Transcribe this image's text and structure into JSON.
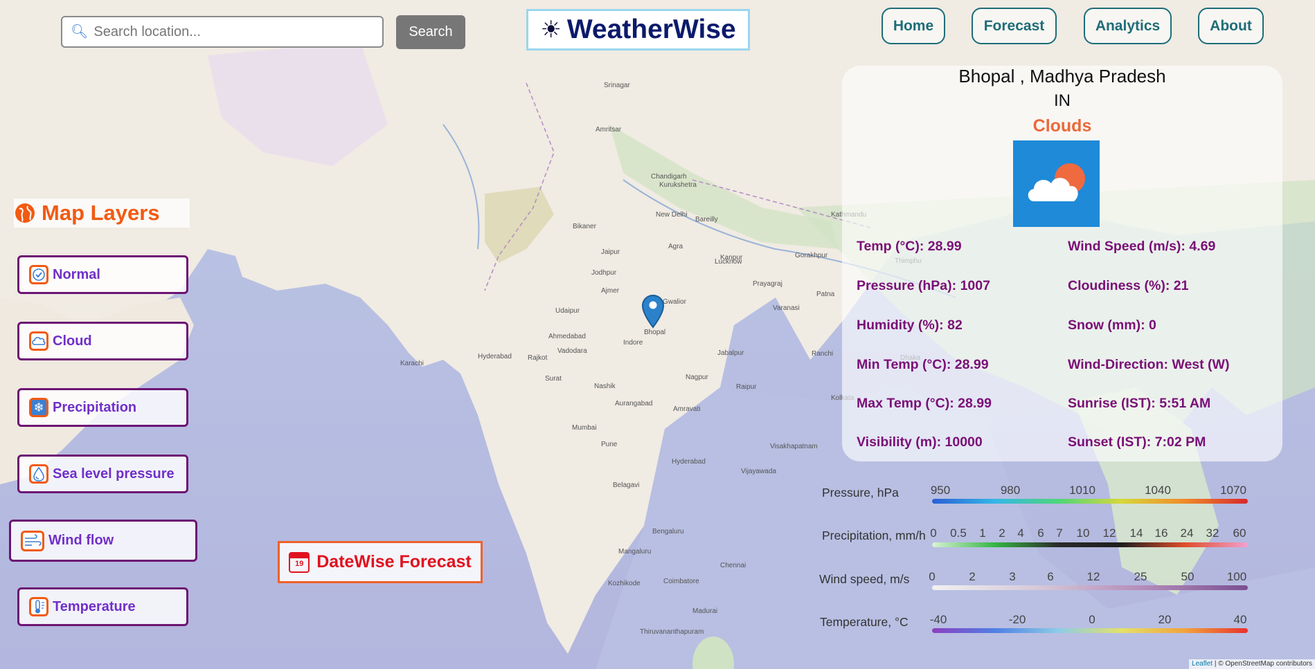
{
  "search": {
    "placeholder": "Search location...",
    "button_label": "Search"
  },
  "brand": {
    "name": "WeatherWise",
    "icon": "sun-icon"
  },
  "nav": [
    "Home",
    "Forecast",
    "Analytics",
    "About"
  ],
  "weather": {
    "city": "Bhopal , Madhya Pradesh",
    "country": "IN",
    "condition": "Clouds",
    "icon": "cloud-sun-icon",
    "details_left": [
      {
        "label": "Temp (°C)",
        "value": "28.99"
      },
      {
        "label": "Pressure (hPa)",
        "value": "1007"
      },
      {
        "label": "Humidity (%)",
        "value": "82"
      },
      {
        "label": "Min Temp (°C)",
        "value": "28.99"
      },
      {
        "label": "Max Temp (°C)",
        "value": "28.99"
      },
      {
        "label": "Visibility (m)",
        "value": "10000"
      }
    ],
    "details_right": [
      {
        "label": "Wind Speed (m/s)",
        "value": "4.69"
      },
      {
        "label": "Cloudiness (%)",
        "value": "21"
      },
      {
        "label": "Snow (mm)",
        "value": "0"
      },
      {
        "label": "Wind-Direction",
        "value": "West (W)"
      },
      {
        "label": "Sunrise (IST)",
        "value": "5:51 AM"
      },
      {
        "label": "Sunset (IST)",
        "value": "7:02 PM"
      }
    ]
  },
  "layers": {
    "title": "Map Layers",
    "items": [
      {
        "label": "Normal",
        "icon": "check-icon"
      },
      {
        "label": "Cloud",
        "icon": "cloud-icon"
      },
      {
        "label": "Precipitation",
        "icon": "snowflake-icon"
      },
      {
        "label": "Sea level pressure",
        "icon": "droplet-icon"
      },
      {
        "label": "Wind flow",
        "icon": "wind-icon"
      },
      {
        "label": "Temperature",
        "icon": "thermometer-icon"
      }
    ]
  },
  "datewise": {
    "label": "DateWise Forecast",
    "icon_day": "19"
  },
  "legends": [
    {
      "label": "Pressure, hPa",
      "ticks": [
        "950",
        "980",
        "1010",
        "1040",
        "1070"
      ]
    },
    {
      "label": "Precipitation, mm/h",
      "ticks": [
        "0",
        "0.5",
        "1",
        "2",
        "4",
        "6",
        "7",
        "10",
        "12",
        "14",
        "16",
        "24",
        "32",
        "60"
      ]
    },
    {
      "label": "Wind speed, m/s",
      "ticks": [
        "0",
        "2",
        "3",
        "6",
        "12",
        "25",
        "50",
        "100"
      ]
    },
    {
      "label": "Temperature, °C",
      "ticks": [
        "-40",
        "-20",
        "0",
        "20",
        "40"
      ]
    }
  ],
  "map_labels": [
    "Srinagar",
    "Amritsar",
    "Chandigarh",
    "Kurukshetra",
    "New Delhi",
    "Bareilly",
    "Bikaner",
    "Jaipur",
    "Lucknow",
    "Gorakhpur",
    "Jodhpur",
    "Ajmer",
    "Agra",
    "Kanpur",
    "Prayagraj",
    "Varanasi",
    "Patna",
    "Udaipur",
    "Gwalior",
    "Jabalpur",
    "Ahmedabad",
    "Bhopal",
    "Vadodara",
    "Indore",
    "Ranchi",
    "Rajkot",
    "Surat",
    "Nagpur",
    "Raipur",
    "Nashik",
    "Amravati",
    "Aurangabad",
    "Mumbai",
    "Pune",
    "Hyderabad",
    "Visakhapatnam",
    "Vijayawada",
    "Belagavi",
    "Bengaluru",
    "Chennai",
    "Mangaluru",
    "Coimbatore",
    "Madurai",
    "Kozhikode",
    "Thiruvananthapuram",
    "Kathmandu",
    "Dhaka",
    "Kolkata",
    "Thimphu",
    "Karachi",
    "Hyderabad"
  ],
  "attribution": {
    "leaflet": "Leaflet",
    "rest": "| © OpenStreetMap contributors"
  },
  "colors": {
    "accent_orange": "#f25a12",
    "layer_border": "#6d1473",
    "detail_text": "#7a0f76",
    "nav_text": "#1e6d78"
  }
}
